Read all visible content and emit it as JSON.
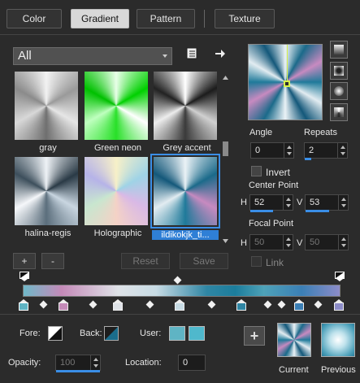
{
  "tabs": [
    {
      "label": "Color"
    },
    {
      "label": "Gradient"
    },
    {
      "label": "Pattern"
    },
    {
      "label": "Texture"
    }
  ],
  "category": {
    "selected": "All"
  },
  "thumbnails": [
    {
      "label": "gray"
    },
    {
      "label": "Green neon"
    },
    {
      "label": "Grey accent"
    },
    {
      "label": "halina-regis"
    },
    {
      "label": "Holographic"
    },
    {
      "label": "ildikokjk_ti..."
    }
  ],
  "buttons": {
    "add": "+",
    "remove": "-",
    "reset": "Reset",
    "save": "Save",
    "plus": "+"
  },
  "angle": {
    "label": "Angle",
    "value": "0"
  },
  "repeats": {
    "label": "Repeats",
    "value": "2"
  },
  "invert": {
    "label": "Invert"
  },
  "center_point": {
    "label": "Center Point",
    "h_label": "H",
    "h_value": "52",
    "v_label": "V",
    "v_value": "53"
  },
  "focal_point": {
    "label": "Focal Point",
    "h_label": "H",
    "h_value": "50",
    "v_label": "V",
    "v_value": "50"
  },
  "link": {
    "label": "Link"
  },
  "fore": {
    "label": "Fore:"
  },
  "back": {
    "label": "Back:"
  },
  "user": {
    "label": "User:"
  },
  "opacity": {
    "label": "Opacity:",
    "value": "100"
  },
  "location": {
    "label": "Location:",
    "value": "0"
  },
  "current": {
    "label": "Current"
  },
  "previous": {
    "label": "Previous"
  },
  "colors": {
    "accent": "#3a8ee6",
    "teal": "#1a6d8c",
    "pink": "#c98bbf",
    "user_swatch_1": "#5fb4c4",
    "user_swatch_2": "#4fb8cc"
  },
  "icons": [
    "layer-icon",
    "arrow-right-icon",
    "linear-style-icon",
    "rectangular-style-icon",
    "sunburst-style-icon",
    "radial-style-icon"
  ]
}
